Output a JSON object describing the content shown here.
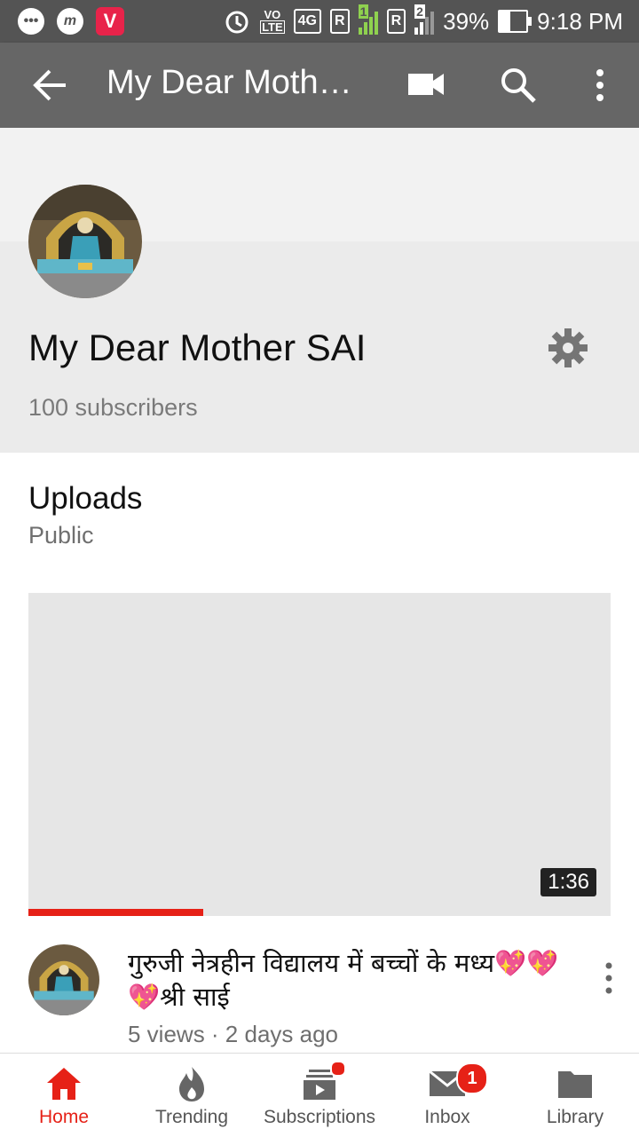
{
  "status_bar": {
    "time": "9:18 PM",
    "battery": "39%",
    "network": "4G",
    "volte_top": "VO",
    "volte_bottom": "LTE",
    "sim1_label": "R",
    "sim2_label": "R",
    "sim1_number": "1",
    "sim2_number": "2",
    "app_icon_m": "m",
    "app_icon_v": "V"
  },
  "app_bar": {
    "title": "My Dear Moth…",
    "icons": [
      "back-arrow-icon",
      "video-camera-icon",
      "search-icon",
      "more-vert-icon"
    ]
  },
  "channel": {
    "name": "My Dear Mother SAI",
    "subscribers": "100 subscribers"
  },
  "section": {
    "title": "Uploads",
    "visibility": "Public"
  },
  "video": {
    "duration": "1:36",
    "watched_fraction": 0.3,
    "title": "गुरुजी नेत्रहीन विद्यालय में बच्चों के मध्य💖💖💖श्री साई",
    "meta": "5 views · 2 days ago"
  },
  "bottom_nav": {
    "items": [
      {
        "label": "Home",
        "icon": "home-icon",
        "active": true
      },
      {
        "label": "Trending",
        "icon": "flame-icon",
        "active": false
      },
      {
        "label": "Subscriptions",
        "icon": "subscriptions-icon",
        "active": false
      },
      {
        "label": "Inbox",
        "icon": "mail-icon",
        "active": false,
        "badge": "1"
      },
      {
        "label": "Library",
        "icon": "folder-icon",
        "active": false
      }
    ]
  },
  "colors": {
    "accent": "#e62117",
    "app_bar": "#666666",
    "status_bar": "#545454"
  }
}
